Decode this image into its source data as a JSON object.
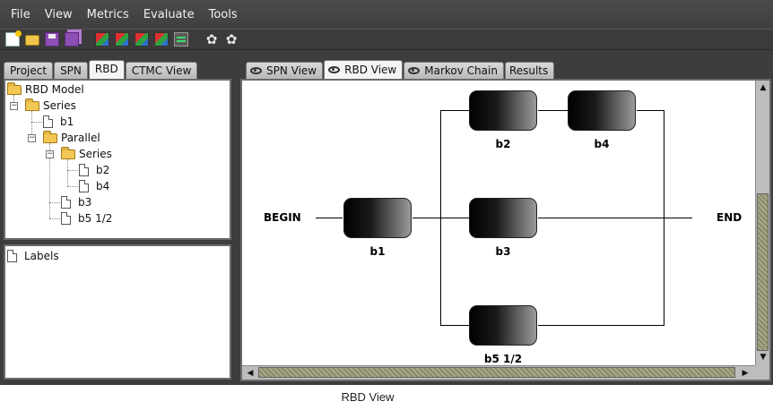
{
  "menu": [
    "File",
    "View",
    "Metrics",
    "Evaluate",
    "Tools"
  ],
  "toolbar": {
    "icons": [
      "new-file-icon",
      "open-folder-icon",
      "save-icon",
      "save-all-icon",
      "add-block-icon",
      "add-series-icon",
      "add-parallel-icon",
      "add-node-icon",
      "console-icon",
      "settings-gear-icon",
      "run-gear-icon"
    ]
  },
  "left_tabs": [
    "Project",
    "SPN",
    "RBD",
    "CTMC View"
  ],
  "left_active_tab": "RBD",
  "tree": {
    "root": "RBD Model",
    "series": "Series",
    "b1": "b1",
    "parallel": "Parallel",
    "inner_series": "Series",
    "b2": "b2",
    "b4": "b4",
    "b3": "b3",
    "b5": "b5 1/2"
  },
  "labels_panel": {
    "item": "Labels"
  },
  "right_tabs": [
    "SPN View",
    "RBD View",
    "Markov Chain",
    "Results"
  ],
  "right_active_tab": "RBD View",
  "diagram": {
    "begin": "BEGIN",
    "end": "END",
    "blocks": {
      "b1": "b1",
      "b2": "b2",
      "b3": "b3",
      "b4": "b4",
      "b5": "b5 1/2"
    }
  },
  "caption": "RBD View"
}
